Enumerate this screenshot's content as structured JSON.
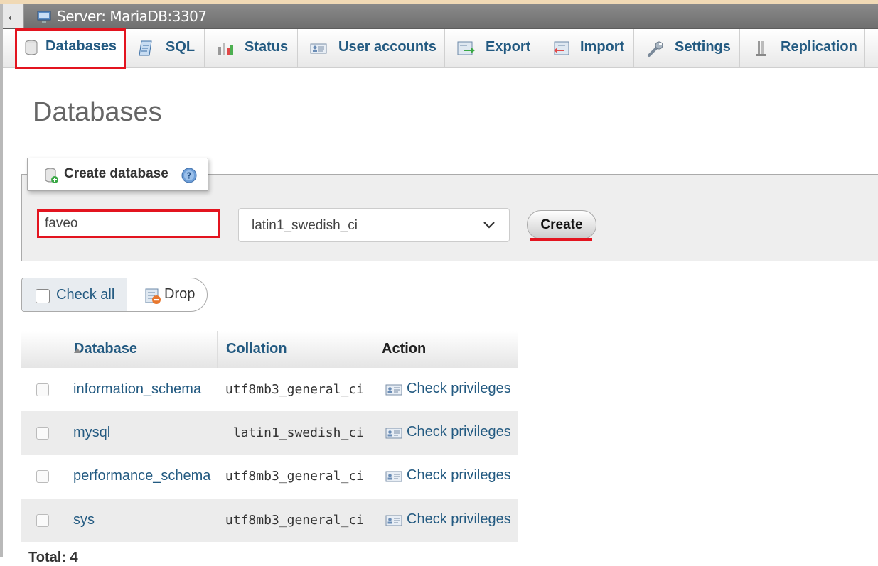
{
  "server": {
    "back_arrow": "←",
    "title": "Server: MariaDB:3307"
  },
  "tabs": [
    {
      "label": "Databases",
      "icon": "database-icon",
      "active": true
    },
    {
      "label": "SQL",
      "icon": "sql-icon",
      "active": false
    },
    {
      "label": "Status",
      "icon": "status-chart-icon",
      "active": false
    },
    {
      "label": "User accounts",
      "icon": "user-accounts-icon",
      "active": false
    },
    {
      "label": "Export",
      "icon": "export-icon",
      "active": false
    },
    {
      "label": "Import",
      "icon": "import-icon",
      "active": false
    },
    {
      "label": "Settings",
      "icon": "wrench-icon",
      "active": false
    },
    {
      "label": "Replication",
      "icon": "replication-icon",
      "active": false
    }
  ],
  "page_title": "Databases",
  "create_db": {
    "legend": "Create database",
    "name_value": "faveo",
    "collation_value": "latin1_swedish_ci",
    "button_label": "Create"
  },
  "bulk": {
    "check_all_label": "Check all",
    "drop_label": "Drop"
  },
  "table": {
    "headers": {
      "database": "Database",
      "collation": "Collation",
      "action": "Action"
    },
    "rows": [
      {
        "name": "information_schema",
        "collation": "utf8mb3_general_ci",
        "action": "Check privileges"
      },
      {
        "name": "mysql",
        "collation": "latin1_swedish_ci",
        "action": "Check privileges"
      },
      {
        "name": "performance_schema",
        "collation": "utf8mb3_general_ci",
        "action": "Check privileges"
      },
      {
        "name": "sys",
        "collation": "utf8mb3_general_ci",
        "action": "Check privileges"
      }
    ],
    "total_label": "Total: 4"
  },
  "colors": {
    "link": "#235a81",
    "highlight_red": "#e3141f",
    "title_gray": "#666666",
    "server_bar": "#7a7a7a"
  }
}
